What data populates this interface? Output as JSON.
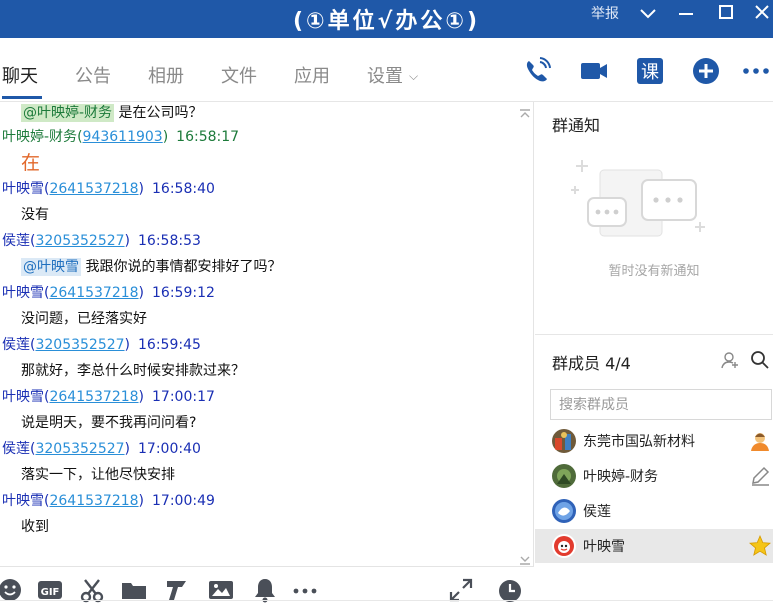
{
  "window": {
    "title": "(①单位√办公①)",
    "report_label": "举报"
  },
  "tabs": [
    {
      "label": "聊天",
      "active": true
    },
    {
      "label": "公告"
    },
    {
      "label": "相册"
    },
    {
      "label": "文件"
    },
    {
      "label": "应用"
    },
    {
      "label": "设置"
    }
  ],
  "toolbar_icons": [
    "phone-icon",
    "video-icon",
    "lesson-icon",
    "plus-circle-icon",
    "more-icon"
  ],
  "lesson_glyph": "课",
  "messages": [
    {
      "type": "mention",
      "mention": "@叶映婷-财务",
      "text": " 是在公司吗？"
    },
    {
      "type": "sender",
      "name": "叶映婷-财务",
      "qq": "943611903",
      "time": "16:58:17",
      "color": "#1c7a3a"
    },
    {
      "type": "text",
      "text": "在",
      "big": true
    },
    {
      "type": "sender",
      "name": "叶映雪",
      "qq": "2641537218",
      "time": "16:58:40",
      "color": "#1a2fb4"
    },
    {
      "type": "text",
      "text": "没有"
    },
    {
      "type": "sender",
      "name": "侯莲",
      "qq": "3205352527",
      "time": "16:58:53",
      "color": "#1a2fb4"
    },
    {
      "type": "mention",
      "mention": "@叶映雪",
      "text": " 我跟你说的事情都安排好了吗？",
      "blue": true
    },
    {
      "type": "sender",
      "name": "叶映雪",
      "qq": "2641537218",
      "time": "16:59:12",
      "color": "#1a2fb4"
    },
    {
      "type": "text",
      "text": "没问题，已经落实好"
    },
    {
      "type": "sender",
      "name": "侯莲",
      "qq": "3205352527",
      "time": "16:59:45",
      "color": "#1a2fb4"
    },
    {
      "type": "text",
      "text": "那就好，李总什么时候安排款过来？"
    },
    {
      "type": "sender",
      "name": "叶映雪",
      "qq": "2641537218",
      "time": "17:00:17",
      "color": "#1a2fb4"
    },
    {
      "type": "text",
      "text": "说是明天，要不我再问问看?"
    },
    {
      "type": "sender",
      "name": "侯莲",
      "qq": "3205352527",
      "time": "17:00:40",
      "color": "#1a2fb4"
    },
    {
      "type": "text",
      "text": "落实一下，让他尽快安排"
    },
    {
      "type": "sender",
      "name": "叶映雪",
      "qq": "2641537218",
      "time": "17:00:49",
      "color": "#1a2fb4"
    },
    {
      "type": "text",
      "text": "收到"
    }
  ],
  "input_toolbar_icons": [
    "emoji-icon",
    "gif-icon",
    "scissors-icon",
    "folder-icon",
    "font-icon",
    "image-icon",
    "bell-icon",
    "more-icon",
    "expand-icon",
    "history-clock-icon"
  ],
  "gif_label": "GIF",
  "notice": {
    "title": "群通知",
    "empty_text": "暂时没有新通知"
  },
  "members": {
    "title": "群成员 4/4",
    "search_placeholder": "搜索群成员",
    "list": [
      {
        "name": "东莞市国弘新材料",
        "badge": "owner-avatar-icon"
      },
      {
        "name": "叶映婷-财务",
        "badge": "edit-icon"
      },
      {
        "name": "侯莲",
        "badge": ""
      },
      {
        "name": "叶映雪",
        "badge": "star-icon",
        "selected": true
      }
    ]
  },
  "colors": {
    "titlebar": "#1f58a8",
    "accent": "#1f58a8",
    "sender_green": "#1c7a3a",
    "sender_blue": "#1a2fb4",
    "qq_link": "#2a8fd8",
    "big_text": "#e2682b"
  }
}
